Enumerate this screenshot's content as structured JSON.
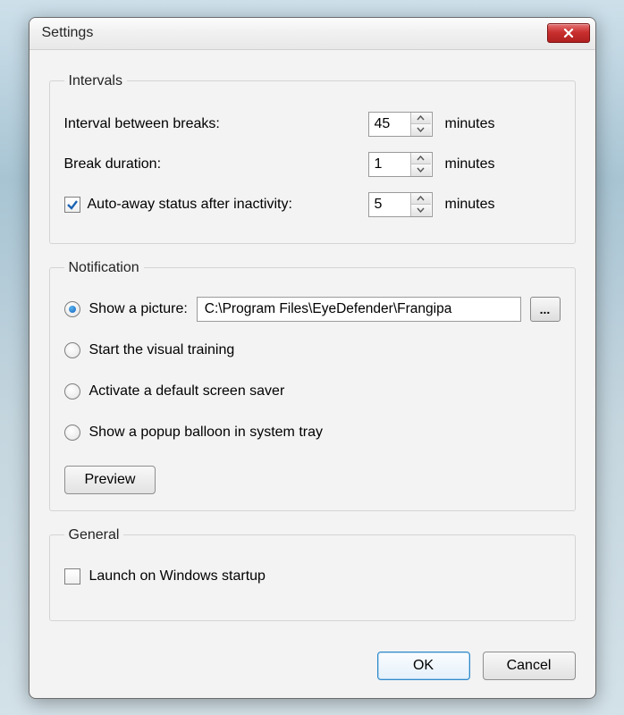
{
  "window": {
    "title": "Settings"
  },
  "intervals": {
    "legend": "Intervals",
    "between_label": "Interval between breaks:",
    "between_value": "45",
    "duration_label": "Break duration:",
    "duration_value": "1",
    "autoaway_label": "Auto-away status after inactivity:",
    "autoaway_checked": true,
    "autoaway_value": "5",
    "unit": "minutes"
  },
  "notification": {
    "legend": "Notification",
    "show_picture_label": "Show a picture:",
    "picture_path": "C:\\Program Files\\EyeDefender\\Frangipa",
    "browse_label": "...",
    "visual_training_label": "Start the visual training",
    "screen_saver_label": "Activate a default screen saver",
    "popup_label": "Show a popup balloon in system tray",
    "preview_label": "Preview",
    "selected": "show_picture"
  },
  "general": {
    "legend": "General",
    "launch_label": "Launch on Windows startup",
    "launch_checked": false
  },
  "footer": {
    "ok": "OK",
    "cancel": "Cancel"
  }
}
